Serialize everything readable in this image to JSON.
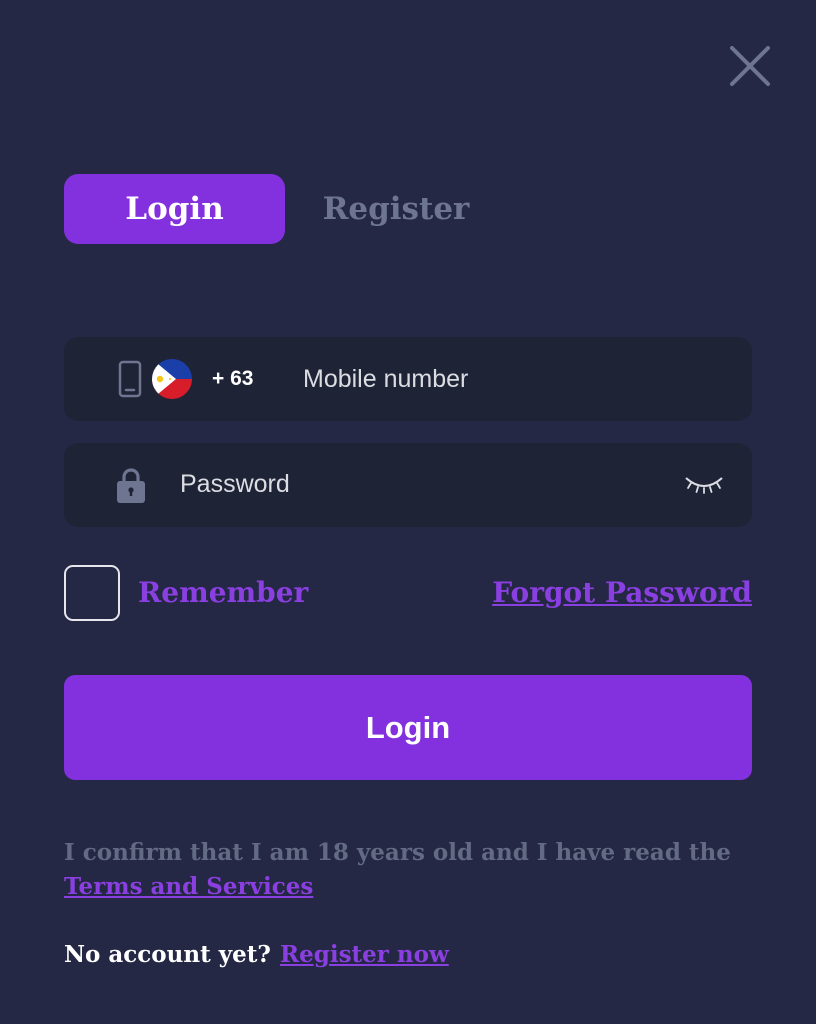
{
  "icons": {
    "close": "close-icon",
    "phone": "mobile-phone-icon",
    "flag": "philippines-flag-icon",
    "lock": "lock-icon",
    "eye": "eye-closed-icon"
  },
  "colors": {
    "background": "#242845",
    "accent": "#8330de",
    "field_background": "#1e2336",
    "muted_text": "#636a84"
  },
  "tabs": [
    {
      "label": "Login",
      "active": true
    },
    {
      "label": "Register",
      "active": false
    }
  ],
  "form": {
    "country_code": "+ 63",
    "mobile_placeholder": "Mobile number",
    "mobile_value": "",
    "password_placeholder": "Password",
    "password_value": "",
    "remember_label": "Remember",
    "remember_checked": false,
    "forgot_password": "Forgot Password",
    "submit_label": "Login"
  },
  "footer": {
    "confirm_text": "I confirm that I am 18 years old and I have read the",
    "terms_link": "Terms and Services",
    "no_account": "No account yet?",
    "register_link": "Register now"
  }
}
